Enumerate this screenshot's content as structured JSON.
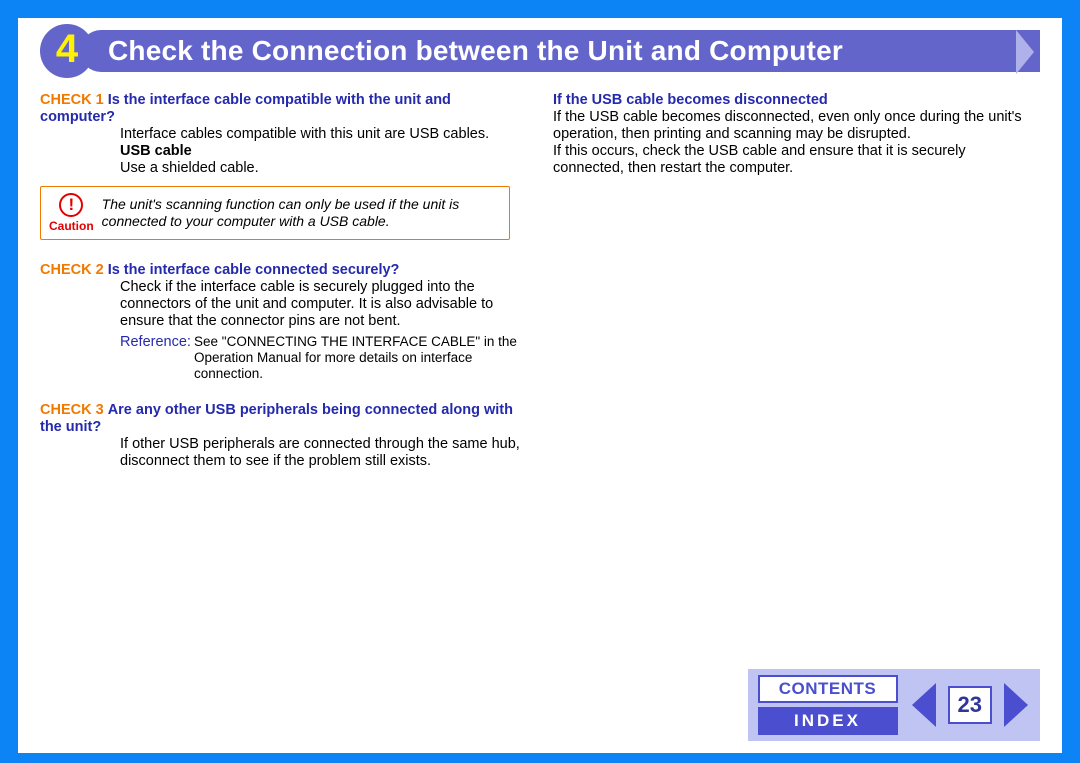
{
  "chapter": {
    "number": "4",
    "title": "Check the Connection between the Unit and Computer"
  },
  "left": {
    "check1": {
      "label": "CHECK 1",
      "question": "Is the interface cable compatible with the unit and computer?",
      "body1": "Interface cables compatible with this unit are USB cables.",
      "usb_label": "USB cable",
      "usb_body": "Use a shielded cable."
    },
    "caution": {
      "label": "Caution",
      "text": "The unit's scanning function can only be used if the unit is connected to your computer with a USB cable."
    },
    "check2": {
      "label": "CHECK 2",
      "question": "Is the interface cable connected securely?",
      "body": "Check if the interface cable is securely plugged into the connectors of the unit and computer. It is also advisable to ensure that the connector pins are not bent.",
      "ref_label": "Reference:",
      "ref_body": "See \"CONNECTING THE INTERFACE CABLE\" in the Operation Manual for more details on interface connection."
    },
    "check3": {
      "label": "CHECK 3",
      "question": "Are any other USB peripherals being connected along with the unit?",
      "body": "If other USB peripherals are connected through the same hub, disconnect them to see if the problem still exists."
    }
  },
  "right": {
    "usb_disconnect": {
      "heading": "If the USB cable becomes disconnected",
      "p1": "If the USB cable becomes disconnected, even only once during the unit's operation, then printing and scanning may be disrupted.",
      "p2": "If this occurs, check the USB cable and ensure that it is securely connected, then restart the computer."
    }
  },
  "footer": {
    "contents": "CONTENTS",
    "index": "INDEX",
    "page": "23"
  }
}
